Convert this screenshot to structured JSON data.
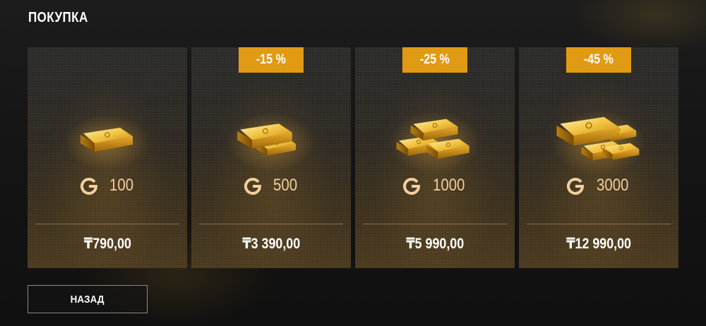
{
  "header": {
    "title": "ПОКУПКА"
  },
  "offers": [
    {
      "discount": "",
      "amount": "100",
      "price": "₸790,00",
      "icon": "gold-bar-icon"
    },
    {
      "discount": "-15 %",
      "amount": "500",
      "price": "₸3 390,00",
      "icon": "gold-bars-icon"
    },
    {
      "discount": "-25 %",
      "amount": "1000",
      "price": "₸5 990,00",
      "icon": "gold-stack-icon"
    },
    {
      "discount": "-45 %",
      "amount": "3000",
      "price": "₸12 990,00",
      "icon": "gold-pile-icon"
    }
  ],
  "currency_icon": "g-coin-icon",
  "footer": {
    "back_label": "НАЗАД"
  },
  "colors": {
    "badge": "#e19a13",
    "amount_text": "#f2cf9e",
    "gold": "#e2a82a"
  }
}
